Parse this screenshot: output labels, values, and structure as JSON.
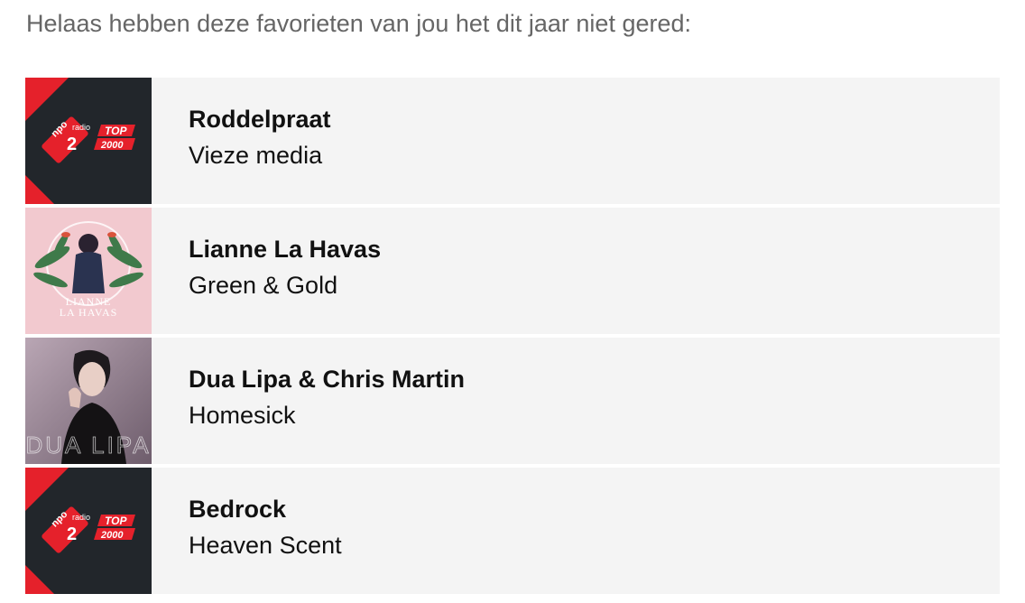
{
  "intro_text": "Helaas hebben deze favorieten van jou het dit jaar niet gered:",
  "colors": {
    "row_bg": "#f4f4f4",
    "npo_red": "#e5212b",
    "npo_dark": "#22262b",
    "intro_text": "#666666"
  },
  "songs": [
    {
      "artist": "Roddelpraat",
      "title": "Vieze media",
      "cover": "npo-radio2-top2000-logo"
    },
    {
      "artist": "Lianne La Havas",
      "title": "Green & Gold",
      "cover": "lianne-la-havas-album-art",
      "cover_text": "LIANNE LA HAVAS"
    },
    {
      "artist": "Dua Lipa & Chris Martin",
      "title": "Homesick",
      "cover": "dua-lipa-album-art",
      "cover_text": "DUA LIPA"
    },
    {
      "artist": "Bedrock",
      "title": "Heaven Scent",
      "cover": "npo-radio2-top2000-logo"
    }
  ],
  "logo": {
    "npo": "npo",
    "radio": "radio",
    "number": "2",
    "top": "TOP",
    "year": "2000"
  }
}
